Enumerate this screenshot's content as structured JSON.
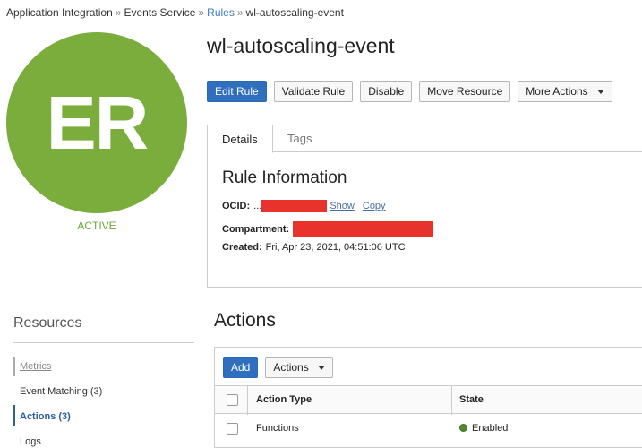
{
  "breadcrumb": {
    "item1": "Application Integration",
    "item2": "Events Service",
    "item3": "Rules",
    "item4": "wl-autoscaling-event",
    "separator": "»"
  },
  "avatar": {
    "initials": "ER",
    "color": "#7aad3c"
  },
  "status": {
    "label": "ACTIVE",
    "color": "#6fa33a"
  },
  "title": "wl-autoscaling-event",
  "buttons": {
    "edit": "Edit Rule",
    "validate": "Validate Rule",
    "disable": "Disable",
    "move": "Move Resource",
    "more": "More Actions",
    "primary_color": "#2f6fbd"
  },
  "tabs": {
    "details": "Details",
    "tags": "Tags"
  },
  "rule_info": {
    "heading": "Rule Information",
    "ocid_label": "OCID:",
    "ocid_prefix": "...",
    "show": "Show",
    "copy": "Copy",
    "compartment_label": "Compartment:",
    "created_label": "Created:",
    "created_value": "Fri, Apr 23, 2021, 04:51:06 UTC",
    "redaction_color": "#e8322c"
  },
  "resources": {
    "title": "Resources",
    "items": [
      "Metrics",
      "Event Matching (3)",
      "Actions (3)",
      "Logs"
    ]
  },
  "actions": {
    "title": "Actions",
    "add_button": "Add",
    "actions_menu": "Actions",
    "columns": [
      "Action Type",
      "State"
    ],
    "rows": [
      {
        "type": "Functions",
        "state": "Enabled",
        "state_color": "#4f8a2b"
      }
    ]
  }
}
